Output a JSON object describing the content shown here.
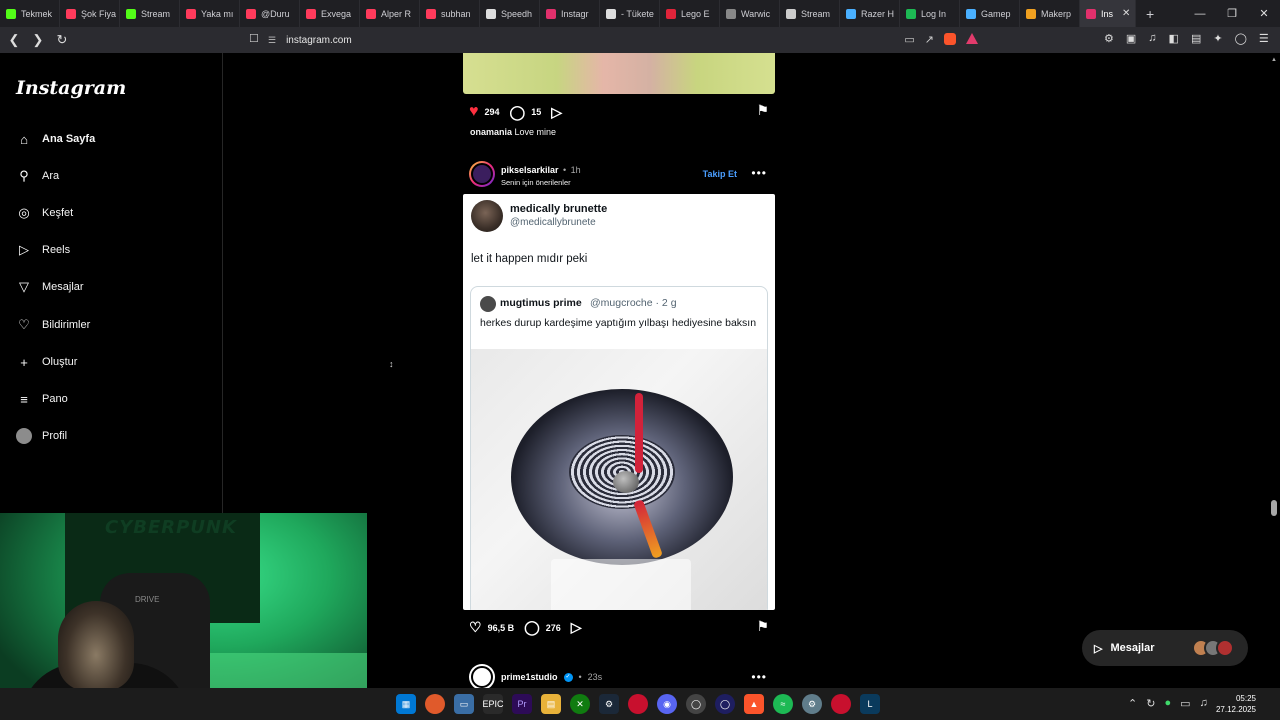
{
  "tabs": [
    {
      "label": "Tekmek",
      "color": "#53fc18"
    },
    {
      "label": "Şok Fiya",
      "color": "#ff3b5c"
    },
    {
      "label": "Stream",
      "color": "#53fc18"
    },
    {
      "label": "Yaka mı",
      "color": "#ff3b5c"
    },
    {
      "label": "@Duru",
      "color": "#ff3b5c"
    },
    {
      "label": "Exvega",
      "color": "#ff3b5c"
    },
    {
      "label": "Alper R",
      "color": "#ff3b5c"
    },
    {
      "label": "subhan",
      "color": "#ff3b5c"
    },
    {
      "label": "Speedh",
      "color": "#dddddd"
    },
    {
      "label": "Instagr",
      "color": "#e1306c"
    },
    {
      "label": "- Tükete",
      "color": "#dddddd"
    },
    {
      "label": "Lego E",
      "color": "#e0243a"
    },
    {
      "label": "Warwic",
      "color": "#888888"
    },
    {
      "label": "Stream",
      "color": "#cccccc"
    },
    {
      "label": "Razer H",
      "color": "#4ab0ff"
    },
    {
      "label": "Log In",
      "color": "#1db954"
    },
    {
      "label": "Gamep",
      "color": "#4ab0ff"
    },
    {
      "label": "Makerp",
      "color": "#f0a020"
    },
    {
      "label": "Ins",
      "color": "#e1306c"
    }
  ],
  "toolbar": {
    "url": "instagram.com"
  },
  "sidebar": {
    "logo": "Instagram",
    "items": [
      {
        "label": "Ana Sayfa",
        "icon": "home-icon"
      },
      {
        "label": "Ara",
        "icon": "search-icon"
      },
      {
        "label": "Keşfet",
        "icon": "compass-icon"
      },
      {
        "label": "Reels",
        "icon": "reels-icon"
      },
      {
        "label": "Mesajlar",
        "icon": "send-icon"
      },
      {
        "label": "Bildirimler",
        "icon": "heart-icon"
      },
      {
        "label": "Oluştur",
        "icon": "plus-icon"
      },
      {
        "label": "Pano",
        "icon": "dashboard-icon"
      },
      {
        "label": "Profil",
        "icon": "avatar"
      }
    ]
  },
  "prev_post": {
    "likes": "294",
    "comments": "15",
    "caption_user": "onamania",
    "caption_text": "Love mine"
  },
  "post": {
    "username": "pikselsarkilar",
    "time": "1h",
    "sub": "Senin için önerilenler",
    "follow": "Takip Et",
    "tweet": {
      "name": "medically brunette",
      "handle": "@medicallybrunete",
      "text": "let it happen mıdır peki",
      "quote": {
        "name": "mugtimus prime",
        "handle": "@mugcroche · 2 g",
        "text": "herkes durup kardeşime yaptığım yılbaşı hediyesine baksın"
      }
    },
    "likes": "96,5 B",
    "comments": "276"
  },
  "next_post": {
    "username": "prime1studio",
    "time": "23s"
  },
  "messages_pill": {
    "label": "Mesajlar"
  },
  "webcam": {
    "poster_text": "CYBERPUNK",
    "chair_text": "DRIVE"
  },
  "clock": {
    "time": "05:25",
    "date": "27.12.2025"
  }
}
